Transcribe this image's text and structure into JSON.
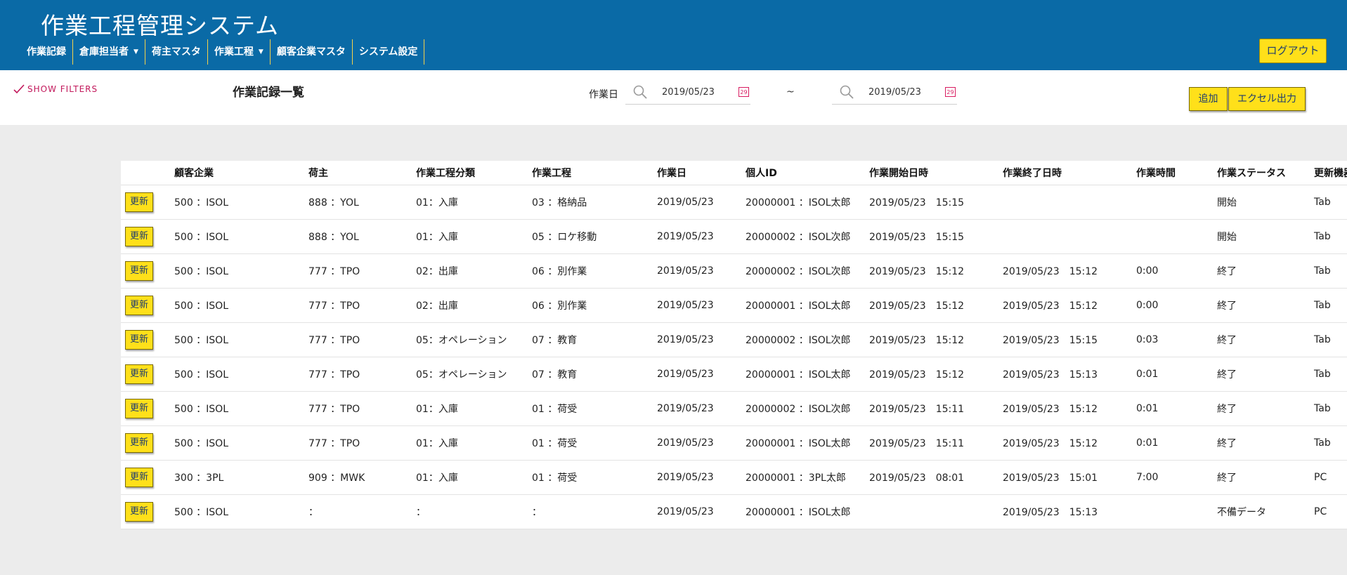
{
  "app": {
    "title": "作業工程管理システム"
  },
  "nav": {
    "items": [
      {
        "label": "作業記録",
        "dropdown": false
      },
      {
        "label": "倉庫担当者",
        "dropdown": true
      },
      {
        "label": "荷主マスタ",
        "dropdown": false
      },
      {
        "label": "作業工程",
        "dropdown": true
      },
      {
        "label": "顧客企業マスタ",
        "dropdown": false
      },
      {
        "label": "システム設定",
        "dropdown": false
      }
    ],
    "logout_label": "ログアウト"
  },
  "toolbar": {
    "show_filters": "SHOW FILTERS",
    "page_title": "作業記録一覧",
    "date_label": "作業日",
    "date_from": "2019/05/23",
    "date_to": "2019/05/23",
    "calendar_icon_text": "29",
    "tilde": "~",
    "add_label": "追加",
    "excel_label": "エクセル出力"
  },
  "table": {
    "update_label": "更新",
    "columns": [
      "",
      "顧客企業",
      "荷主",
      "作業工程分類",
      "作業工程",
      "作業日",
      "個人ID",
      "作業開始日時",
      "作業終了日時",
      "作業時間",
      "作業ステータス",
      "更新機器"
    ],
    "rows": [
      [
        "500 ：ISOL",
        "888 ：YOL",
        "01：入庫",
        "03 ：格納品",
        "2019/05/23",
        "20000001 ：ISOL太郎",
        "2019/05/23　15:15",
        "",
        "",
        "開始",
        "Tab"
      ],
      [
        "500 ：ISOL",
        "888 ：YOL",
        "01：入庫",
        "05 ：ロケ移動",
        "2019/05/23",
        "20000002 ：ISOL次郎",
        "2019/05/23　15:15",
        "",
        "",
        "開始",
        "Tab"
      ],
      [
        "500 ：ISOL",
        "777 ：TPO",
        "02：出庫",
        "06 ：別作業",
        "2019/05/23",
        "20000002 ：ISOL次郎",
        "2019/05/23　15:12",
        "2019/05/23　15:12",
        "0:00",
        "終了",
        "Tab"
      ],
      [
        "500 ：ISOL",
        "777 ：TPO",
        "02：出庫",
        "06 ：別作業",
        "2019/05/23",
        "20000001 ：ISOL太郎",
        "2019/05/23　15:12",
        "2019/05/23　15:12",
        "0:00",
        "終了",
        "Tab"
      ],
      [
        "500 ：ISOL",
        "777 ：TPO",
        "05：オペレーション",
        "07 ：教育",
        "2019/05/23",
        "20000002 ：ISOL次郎",
        "2019/05/23　15:12",
        "2019/05/23　15:15",
        "0:03",
        "終了",
        "Tab"
      ],
      [
        "500 ：ISOL",
        "777 ：TPO",
        "05：オペレーション",
        "07 ：教育",
        "2019/05/23",
        "20000001 ：ISOL太郎",
        "2019/05/23　15:12",
        "2019/05/23　15:13",
        "0:01",
        "終了",
        "Tab"
      ],
      [
        "500 ：ISOL",
        "777 ：TPO",
        "01：入庫",
        "01 ：荷受",
        "2019/05/23",
        "20000002 ：ISOL次郎",
        "2019/05/23　15:11",
        "2019/05/23　15:12",
        "0:01",
        "終了",
        "Tab"
      ],
      [
        "500 ：ISOL",
        "777 ：TPO",
        "01：入庫",
        "01 ：荷受",
        "2019/05/23",
        "20000001 ：ISOL太郎",
        "2019/05/23　15:11",
        "2019/05/23　15:12",
        "0:01",
        "終了",
        "Tab"
      ],
      [
        "300 ：3PL",
        "909 ：MWK",
        "01：入庫",
        "01 ：荷受",
        "2019/05/23",
        "20000001 ：3PL太郎",
        "2019/05/23　08:01",
        "2019/05/23　15:01",
        "7:00",
        "終了",
        "PC"
      ],
      [
        "500 ：ISOL",
        "：",
        "：",
        "：",
        "2019/05/23",
        "20000001 ：ISOL太郎",
        "",
        "2019/05/23　15:13",
        "",
        "不備データ",
        "PC"
      ]
    ]
  },
  "colors": {
    "header_bg": "#0a6aa6",
    "accent_yellow": "#ffe01a",
    "filters_pink": "#c2185b"
  }
}
